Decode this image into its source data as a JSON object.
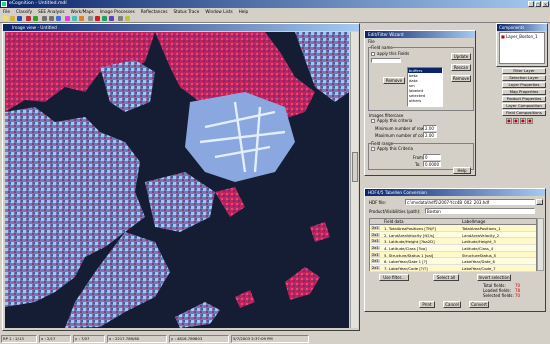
{
  "app": {
    "title": "eCognition - Untitled.mdl"
  },
  "menu": [
    "File",
    "Classify",
    "SEE Analysis",
    "Work/Maps",
    "Image Processes",
    "Reflectances",
    "Status Trace",
    "Window Lists",
    "Help"
  ],
  "image_window": {
    "title": "Image view - Untitled"
  },
  "filter_dialog": {
    "title": "Edit/Filter Wizard",
    "menu": "File",
    "group_label": "Field name",
    "check1": "apply this Fields",
    "btn_remove": "Remove",
    "btn_update": "Update",
    "btn_rescan": "Rescan",
    "btn_remove2": "Remove",
    "options": [
      "buffers",
      "beta",
      "data",
      "sm",
      "labeled",
      "selected",
      "others"
    ],
    "section2": "Images filtercase",
    "check2": "Apply this criteria",
    "min_rows_label": "Minimum number of rows:",
    "min_rows": "2.00",
    "max_cols_label": "Maximum number of columns:",
    "max_cols": "2.00",
    "section3": "Field range",
    "check3": "Apply this Criteria",
    "from_label": "From:",
    "from_value": "0",
    "to_label": "To:",
    "to_value": "0.0000",
    "help": "Help"
  },
  "convert_dialog": {
    "title": "HDF4/5 Tabellen Conversion",
    "file_label": "HDF file:",
    "file_value": "c:\\mydata\\hdf5\\2007-Ycc4B_002_203.hdf",
    "product_label": "Product/Visibilities (path):",
    "product_value": "Boston",
    "col_source": "Field data",
    "col_target": "LabelImage",
    "rows": [
      {
        "n": "2x1",
        "src": "1. TotalAreaPositions [TN/F]",
        "tgt": "TotalAreaPositions_1"
      },
      {
        "n": "2x1",
        "src": "2. LandAreaVelocity [ft2/s]",
        "tgt": "LandAreaVelocity_2"
      },
      {
        "n": "2x1",
        "src": "3. Latitude/Height [?ba2D]",
        "tgt": "Latitude/Height_3"
      },
      {
        "n": "2x1",
        "src": "4. Latitude/Class [?ba]",
        "tgt": "Latitude/Class_4"
      },
      {
        "n": "2x1",
        "src": "5. Structure/Status 1 [val]",
        "tgt": "StructureStatus_5"
      },
      {
        "n": "2x1",
        "src": "6. LabelYear/Date 1 [?]",
        "tgt": "LabelYear/Date_6"
      },
      {
        "n": "2x1",
        "src": "7. LabelYear/Code [?/?]",
        "tgt": "LabelYear/Code_7"
      }
    ],
    "btn_use": "Use filter...",
    "btn_select": "Select all",
    "btn_invert": "Invert selection",
    "total_label": "Total fields:",
    "total": "70",
    "loaded_label": "Loaded fields:",
    "loaded": "78",
    "selected_label": "Selected fields:",
    "selected": "70",
    "btn_print": "Print",
    "btn_cancel": "Cancel",
    "btn_ok": "Convert"
  },
  "tree_panel": {
    "title": "Components",
    "item": "Layer_Boston_1"
  },
  "side_buttons": [
    "Filter Layer",
    "Selection Layer",
    "Layer Properties",
    "Map Properties",
    "Product Properties",
    "Layer Composition",
    "Field Compositions"
  ],
  "statusbar": [
    "RP 1 : 2/13",
    "x : 2/17",
    "y : 7/07",
    "x : 2217.789/60",
    "y : 4816.789803",
    "5/7/2003 5:37:09 PM"
  ]
}
